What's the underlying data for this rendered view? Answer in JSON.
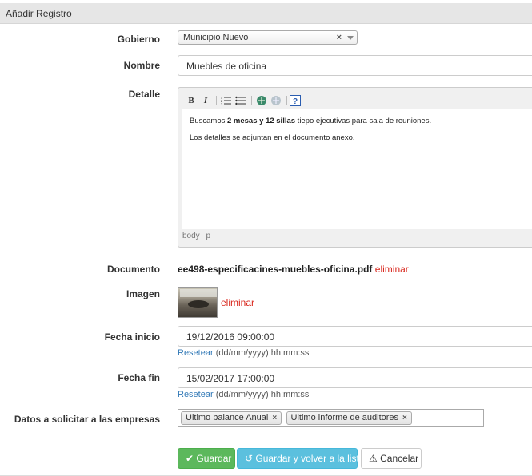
{
  "panel": {
    "title": "Añadir Registro"
  },
  "form": {
    "gobierno": {
      "label": "Gobierno",
      "value": "Municipio Nuevo",
      "clear_icon": "×"
    },
    "nombre": {
      "label": "Nombre",
      "value": "Muebles de oficina"
    },
    "detalle": {
      "label": "Detalle",
      "toolbar": [
        "B",
        "I",
        "ordered-list",
        "unordered-list",
        "link",
        "unlink",
        "help"
      ],
      "para1_prefix": "Buscamos ",
      "para1_bold": "2 mesas y 12 sillas",
      "para1_suffix": " tiepo ejecutivas para sala de reuniones.",
      "para2": "Los detalles se adjuntan en el documento anexo.",
      "status_path": [
        "body",
        "p"
      ]
    },
    "documento": {
      "label": "Documento",
      "filename": "ee498-especificacines-muebles-oficina.pdf",
      "remove": "eliminar"
    },
    "imagen": {
      "label": "Imagen",
      "remove": "eliminar"
    },
    "fecha_inicio": {
      "label": "Fecha inicio",
      "value": "19/12/2016 09:00:00",
      "reset": "Resetear",
      "format": "(dd/mm/yyyy) hh:mm:ss"
    },
    "fecha_fin": {
      "label": "Fecha fin",
      "value": "15/02/2017 17:00:00",
      "reset": "Resetear",
      "format": "(dd/mm/yyyy) hh:mm:ss"
    },
    "datos": {
      "label": "Datos a solicitar a las empresas",
      "tags": [
        "Ultimo balance Anual",
        "Ultimo informe de auditores"
      ],
      "remove_icon": "×"
    }
  },
  "buttons": {
    "save": "Guardar",
    "save_back": "Guardar y volver a la lista",
    "cancel": "Cancelar"
  },
  "colors": {
    "save": "#5cb85c",
    "save_back": "#5bc0de",
    "danger": "#d9281e",
    "link": "#337ab7"
  }
}
